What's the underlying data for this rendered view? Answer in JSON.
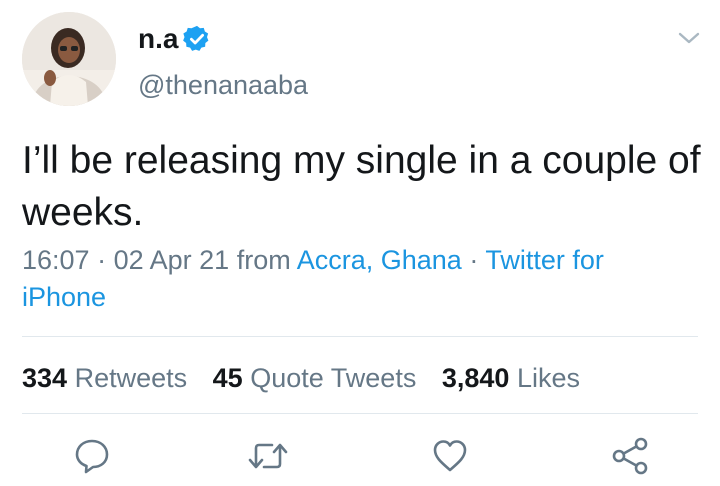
{
  "tweet": {
    "author": {
      "display_name": "n.a",
      "handle": "@thenanaaba",
      "verified": true
    },
    "text": "I’ll be releasing my single in a couple of weeks.",
    "time": "16:07",
    "date": "02 Apr 21",
    "from_label": "from",
    "location": "Accra, Ghana",
    "separator": "·",
    "source": "Twitter for iPhone"
  },
  "stats": {
    "retweets": {
      "count": "334",
      "label": "Retweets"
    },
    "quotes": {
      "count": "45",
      "label": "Quote Tweets"
    },
    "likes": {
      "count": "3,840",
      "label": "Likes"
    }
  },
  "colors": {
    "text": "#14171a",
    "secondary": "#657786",
    "link": "#1b95e0",
    "verified": "#1da1f2",
    "divider": "#e1e8ed"
  },
  "icons": {
    "verified": "verified-badge-icon",
    "menu": "chevron-down-icon",
    "reply": "reply-icon",
    "retweet": "retweet-icon",
    "like": "heart-icon",
    "share": "share-icon"
  }
}
